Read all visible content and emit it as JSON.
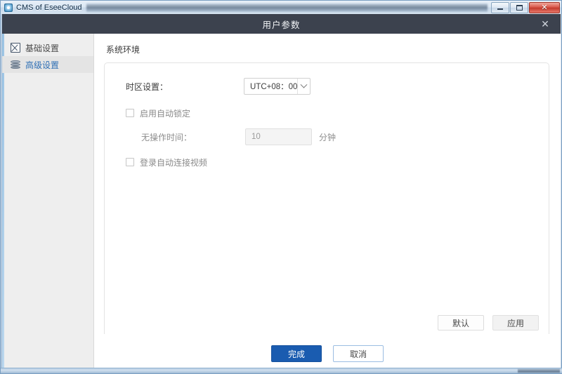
{
  "window": {
    "title": "CMS of EseeCloud",
    "app_icon": "app-globe-icon",
    "controls": {
      "minimize": "—",
      "maximize": "□",
      "close": "✕"
    }
  },
  "dialog": {
    "title": "用户参数",
    "close_label": "✕"
  },
  "sidebar": {
    "items": [
      {
        "label": "基础设置",
        "icon": "monitor-icon",
        "selected": false
      },
      {
        "label": "高级设置",
        "icon": "layers-icon",
        "selected": true
      }
    ]
  },
  "main": {
    "section_title": "系统环境",
    "timezone": {
      "label": "时区设置：",
      "value": "UTC+08：00",
      "arrow_icon": "chevron-down-icon"
    },
    "auto_lock": {
      "label": "启用自动锁定",
      "checked": false
    },
    "idle_time": {
      "label": "无操作时间：",
      "value": "10",
      "unit": "分钟"
    },
    "auto_connect_video": {
      "label": "登录自动连接视频",
      "checked": false
    },
    "buttons": {
      "default": "默认",
      "apply": "应用"
    }
  },
  "footer": {
    "finish": "完成",
    "cancel": "取消"
  },
  "colors": {
    "primary": "#1a5cb0",
    "dialog_header": "#3c424e",
    "selected_text": "#2f6fb5",
    "close_red": "#c23b2e"
  }
}
